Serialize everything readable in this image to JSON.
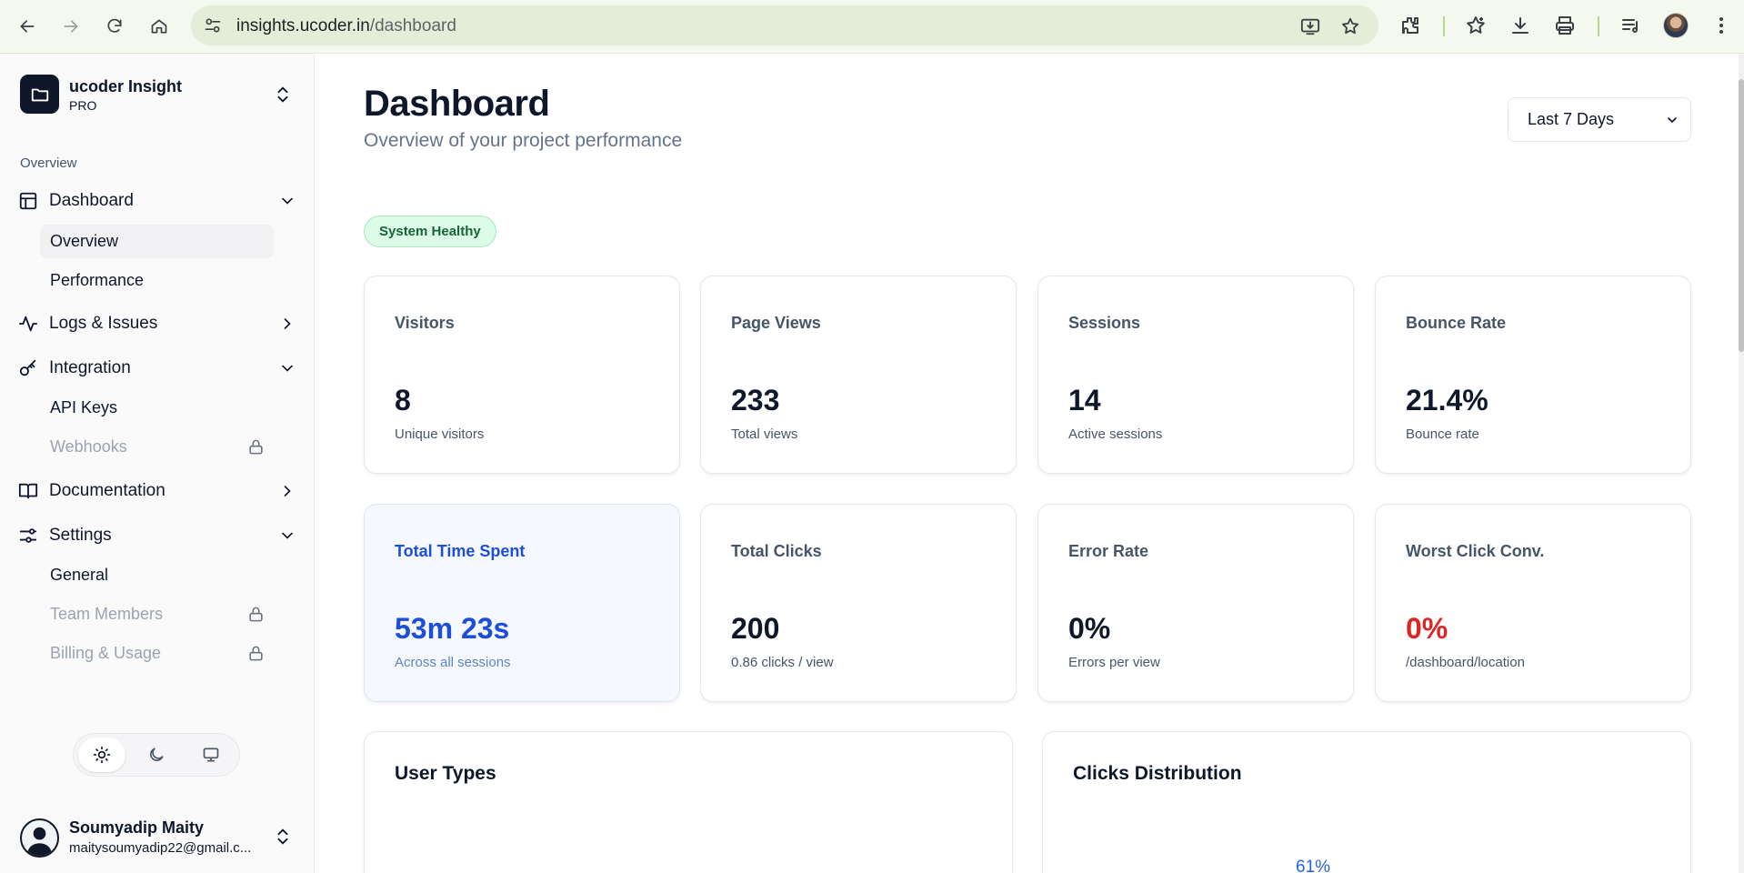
{
  "browser": {
    "url_host": "insights.ucoder.in",
    "url_path": "/dashboard"
  },
  "sidebar": {
    "brand_name": "ucoder Insight",
    "brand_plan": "PRO",
    "section_label": "Overview",
    "groups": [
      {
        "label": "Dashboard",
        "icon": "layout-icon",
        "expanded": true,
        "items": [
          {
            "label": "Overview",
            "active": true
          },
          {
            "label": "Performance"
          }
        ]
      },
      {
        "label": "Logs & Issues",
        "icon": "activity-icon",
        "expanded": false
      },
      {
        "label": "Integration",
        "icon": "key-icon",
        "expanded": true,
        "items": [
          {
            "label": "API Keys"
          },
          {
            "label": "Webhooks",
            "locked": true
          }
        ]
      },
      {
        "label": "Documentation",
        "icon": "book-icon",
        "expanded": false
      },
      {
        "label": "Settings",
        "icon": "settings-sliders-icon",
        "expanded": true,
        "items": [
          {
            "label": "General"
          },
          {
            "label": "Team Members",
            "locked": true
          },
          {
            "label": "Billing & Usage",
            "locked": true
          }
        ]
      }
    ],
    "theme": {
      "active": "light",
      "options": [
        "light",
        "dark",
        "system"
      ]
    },
    "user": {
      "name": "Soumyadip Maity",
      "email": "maitysoumyadip22@gmail.c..."
    }
  },
  "main": {
    "title": "Dashboard",
    "subtitle": "Overview of your project performance",
    "range": "Last 7 Days",
    "status": "System Healthy",
    "stats": [
      {
        "title": "Visitors",
        "value": "8",
        "desc": "Unique visitors"
      },
      {
        "title": "Page Views",
        "value": "233",
        "desc": "Total views"
      },
      {
        "title": "Sessions",
        "value": "14",
        "desc": "Active sessions"
      },
      {
        "title": "Bounce Rate",
        "value": "21.4%",
        "desc": "Bounce rate"
      },
      {
        "title": "Total Time Spent",
        "value": "53m 23s",
        "desc": "Across all sessions"
      },
      {
        "title": "Total Clicks",
        "value": "200",
        "desc": "0.86 clicks / view"
      },
      {
        "title": "Error Rate",
        "value": "0%",
        "desc": "Errors per view"
      },
      {
        "title": "Worst Click Conv.",
        "value": "0%",
        "desc": "/dashboard/location"
      }
    ],
    "panels": [
      {
        "title": "User Types"
      },
      {
        "title": "Clicks Distribution",
        "pie_label": "61%"
      }
    ]
  },
  "colors": {
    "accent_blue": "#1d4ed8",
    "danger_red": "#dc2626",
    "healthy_green": "#166534"
  }
}
